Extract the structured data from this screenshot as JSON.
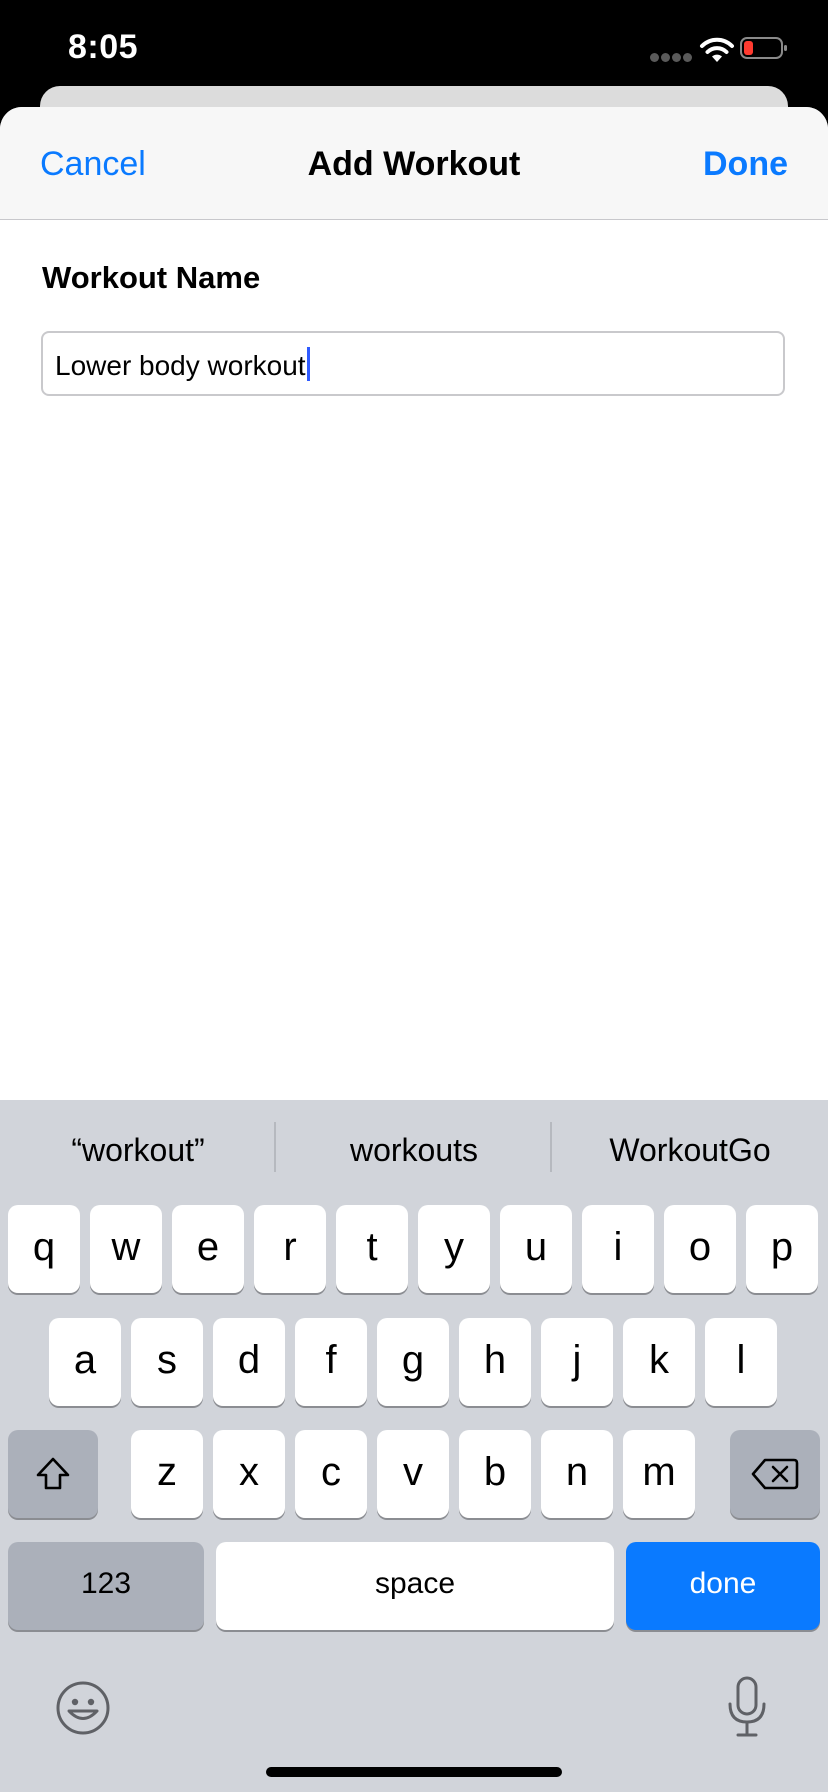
{
  "status_bar": {
    "time": "8:05"
  },
  "nav": {
    "cancel_label": "Cancel",
    "title": "Add Workout",
    "done_label": "Done"
  },
  "form": {
    "field_label": "Workout Name",
    "field_value": "Lower body workout"
  },
  "keyboard": {
    "suggestions": [
      "“workout”",
      "workouts",
      "WorkoutGo"
    ],
    "row1": [
      "q",
      "w",
      "e",
      "r",
      "t",
      "y",
      "u",
      "i",
      "o",
      "p"
    ],
    "row2": [
      "a",
      "s",
      "d",
      "f",
      "g",
      "h",
      "j",
      "k",
      "l"
    ],
    "row3": [
      "z",
      "x",
      "c",
      "v",
      "b",
      "n",
      "m"
    ],
    "numbers_label": "123",
    "space_label": "space",
    "done_label": "done",
    "icons": {
      "shift": "shift-icon",
      "delete": "delete-icon",
      "emoji": "emoji-icon",
      "mic": "microphone-icon"
    }
  },
  "colors": {
    "accent": "#0a7aff",
    "keyboard_bg": "#d1d4da",
    "function_key": "#abb0ba",
    "caret": "#2f5bff"
  }
}
